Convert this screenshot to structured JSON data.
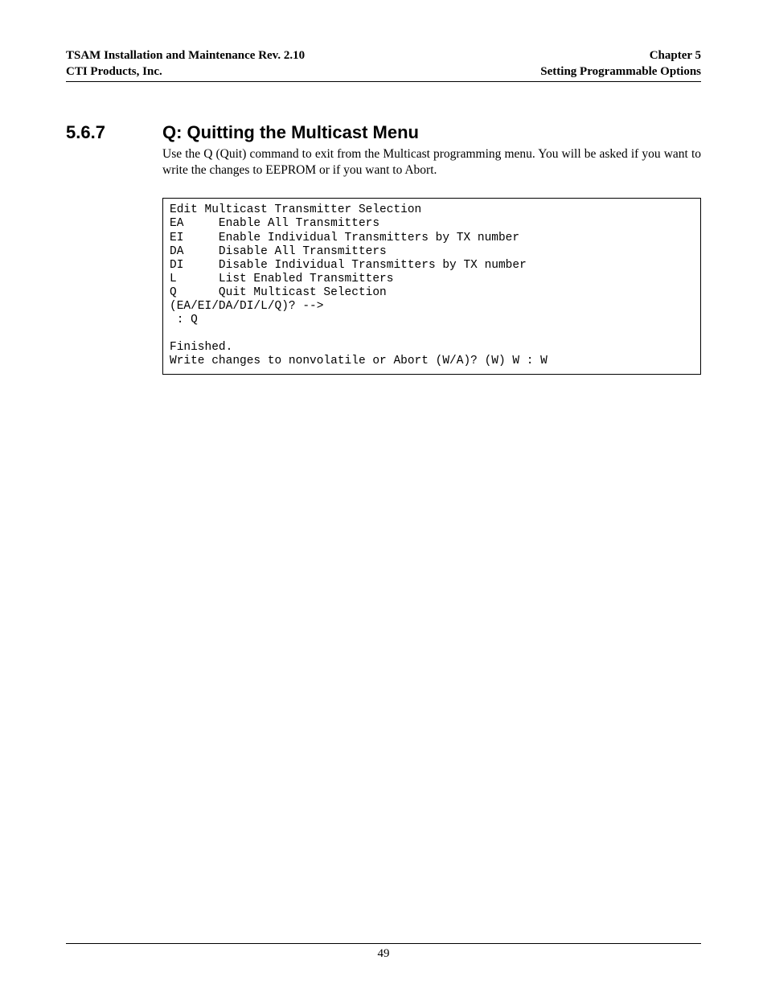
{
  "header": {
    "left_line1": "TSAM Installation and Maintenance Rev. 2.10",
    "left_line2": "CTI Products, Inc.",
    "right_line1": "Chapter 5",
    "right_line2": "Setting Programmable Options"
  },
  "section": {
    "number": "5.6.7",
    "title": "Q:  Quitting the Multicast Menu",
    "body": "Use the Q (Quit) command to exit from the Multicast programming menu.  You will be asked if you want to write the changes to EEPROM or if you want to Abort."
  },
  "code_block": "Edit Multicast Transmitter Selection\nEA     Enable All Transmitters\nEI     Enable Individual Transmitters by TX number\nDA     Disable All Transmitters\nDI     Disable Individual Transmitters by TX number\nL      List Enabled Transmitters\nQ      Quit Multicast Selection\n(EA/EI/DA/DI/L/Q)? -->\n : Q\n\nFinished.\nWrite changes to nonvolatile or Abort (W/A)? (W) W : W",
  "footer": {
    "page_number": "49"
  }
}
